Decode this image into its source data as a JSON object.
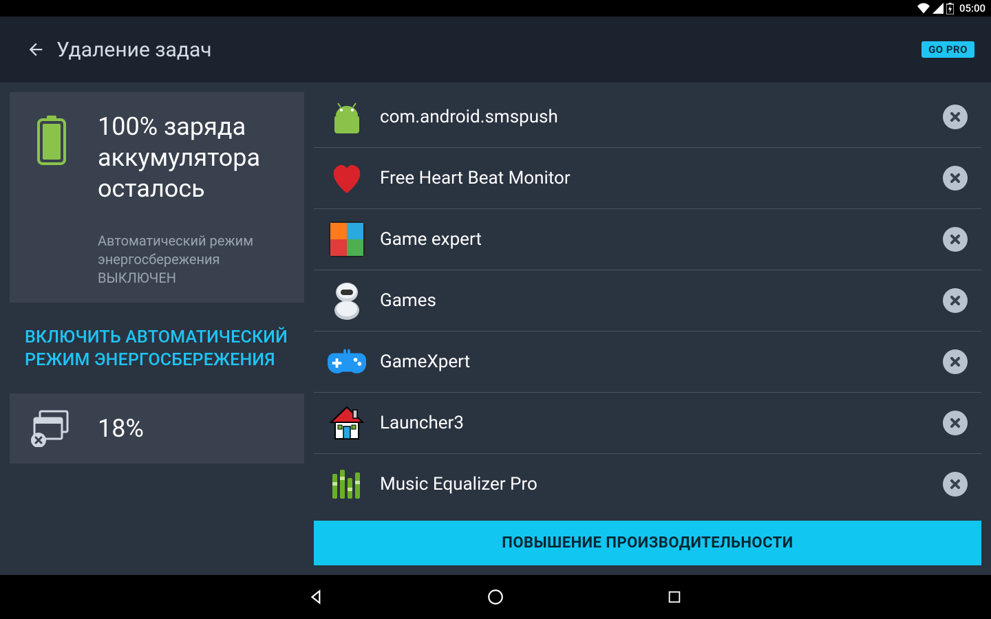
{
  "statusbar": {
    "time": "05:00"
  },
  "appbar": {
    "title": "Удаление задач",
    "go_pro": "GO PRO"
  },
  "sidebar": {
    "battery": {
      "percent": "100%",
      "remaining": "заряда аккумулятора осталось",
      "auto_status": "Автоматический режим энергосбережения ВЫКЛЮЧЕН"
    },
    "enable_auto": "ВКЛЮЧИТЬ АВТОМАТИЧЕСКИЙ РЕЖИМ ЭНЕРГОСБЕРЕЖЕНИЯ",
    "storage": {
      "percent": "18%"
    }
  },
  "tasks": [
    {
      "name": "com.android.smspush",
      "icon": "android"
    },
    {
      "name": "Free Heart Beat Monitor",
      "icon": "heart"
    },
    {
      "name": "Game expert",
      "icon": "quad"
    },
    {
      "name": "Games",
      "icon": "robot"
    },
    {
      "name": "GameXpert",
      "icon": "gamepad"
    },
    {
      "name": "Launcher3",
      "icon": "house"
    },
    {
      "name": "Music Equalizer Pro",
      "icon": "equalizer"
    }
  ],
  "boost_button": "ПОВЫШЕНИЕ ПРОИЗВОДИТЕЛЬНОСТИ"
}
